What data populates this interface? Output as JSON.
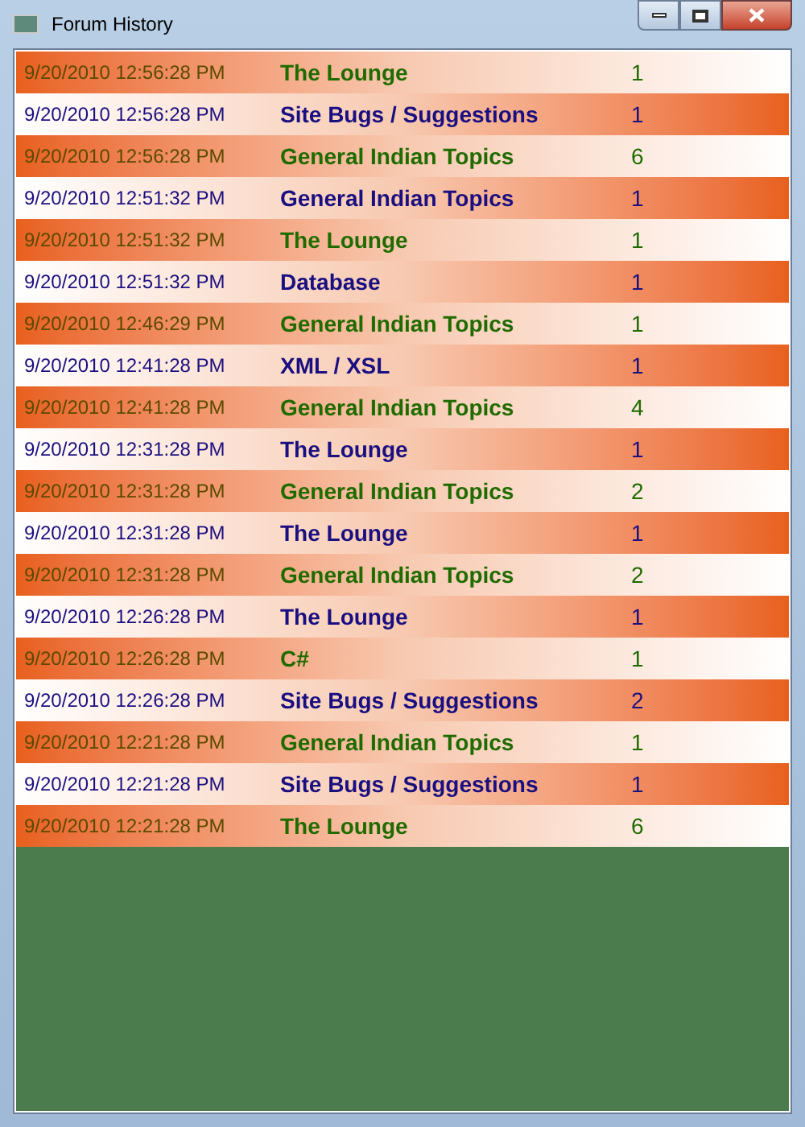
{
  "window": {
    "title": "Forum History"
  },
  "rows": [
    {
      "kind": "orange",
      "date": "9/20/2010 12:56:28 PM",
      "forum": "The Lounge",
      "count": "1"
    },
    {
      "kind": "white",
      "date": "9/20/2010 12:56:28 PM",
      "forum": "Site Bugs / Suggestions",
      "count": "1"
    },
    {
      "kind": "orange",
      "date": "9/20/2010 12:56:28 PM",
      "forum": "General Indian Topics",
      "count": "6"
    },
    {
      "kind": "white",
      "date": "9/20/2010 12:51:32 PM",
      "forum": "General Indian Topics",
      "count": "1"
    },
    {
      "kind": "orange",
      "date": "9/20/2010 12:51:32 PM",
      "forum": "The Lounge",
      "count": "1"
    },
    {
      "kind": "white",
      "date": "9/20/2010 12:51:32 PM",
      "forum": "Database",
      "count": "1"
    },
    {
      "kind": "orange",
      "date": "9/20/2010 12:46:29 PM",
      "forum": "General Indian Topics",
      "count": "1"
    },
    {
      "kind": "white",
      "date": "9/20/2010 12:41:28 PM",
      "forum": "XML / XSL",
      "count": "1"
    },
    {
      "kind": "orange",
      "date": "9/20/2010 12:41:28 PM",
      "forum": "General Indian Topics",
      "count": "4"
    },
    {
      "kind": "white",
      "date": "9/20/2010 12:31:28 PM",
      "forum": "The Lounge",
      "count": "1"
    },
    {
      "kind": "orange",
      "date": "9/20/2010 12:31:28 PM",
      "forum": "General Indian Topics",
      "count": "2"
    },
    {
      "kind": "white",
      "date": "9/20/2010 12:31:28 PM",
      "forum": "The Lounge",
      "count": "1"
    },
    {
      "kind": "orange",
      "date": "9/20/2010 12:31:28 PM",
      "forum": "General Indian Topics",
      "count": "2"
    },
    {
      "kind": "white",
      "date": "9/20/2010 12:26:28 PM",
      "forum": "The Lounge",
      "count": "1"
    },
    {
      "kind": "orange",
      "date": "9/20/2010 12:26:28 PM",
      "forum": "C#",
      "count": "1"
    },
    {
      "kind": "white",
      "date": "9/20/2010 12:26:28 PM",
      "forum": "Site Bugs / Suggestions",
      "count": "2"
    },
    {
      "kind": "orange",
      "date": "9/20/2010 12:21:28 PM",
      "forum": "General Indian Topics",
      "count": "1"
    },
    {
      "kind": "white",
      "date": "9/20/2010 12:21:28 PM",
      "forum": "Site Bugs / Suggestions",
      "count": "1"
    },
    {
      "kind": "orange",
      "date": "9/20/2010 12:21:28 PM",
      "forum": "The Lounge",
      "count": "6"
    }
  ]
}
